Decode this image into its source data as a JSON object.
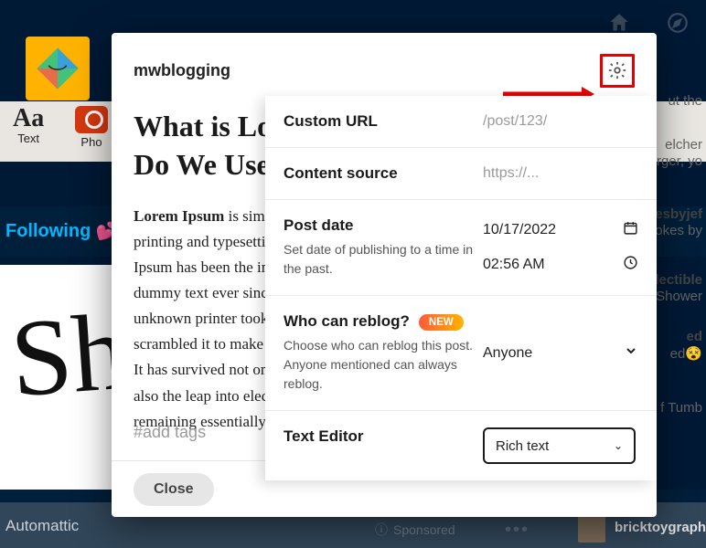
{
  "background": {
    "tools": {
      "text": "Text",
      "photo": "Pho"
    },
    "following": "Following  💕",
    "footer_brand": "Automattic",
    "sponsored": "Sponsored",
    "bottom_user": "bricktoygraph",
    "side_labels": [
      "ut the",
      "elcher",
      "rger, yo",
      "kesbyjef",
      "okes by",
      "lectible",
      "t Shower",
      "ed",
      "ed😵",
      "f Tumb"
    ]
  },
  "compose": {
    "blog_name": "mwblogging",
    "title": "What is Lorem Ipsum? Why Do We Use It?",
    "body_bold": "Lorem Ipsum",
    "body_rest": " is simply dummy text of the printing and typesetting industry. Lorem Ipsum has been the industry's standard dummy text ever since the 1500s, when an unknown printer took a galley of type and scrambled it to make a type specimen book. It has survived not only five centuries, but also the leap into electronic typesetting, remaining essentially unchanged.",
    "tags_placeholder": "#add tags",
    "close": "Close"
  },
  "settings": {
    "custom_url": {
      "label": "Custom URL",
      "value": "/post/123/"
    },
    "content_source": {
      "label": "Content source",
      "value": "https://..."
    },
    "post_date": {
      "label": "Post date",
      "sub": "Set date of publishing to a time in the past.",
      "date": "10/17/2022",
      "time": "02:56 AM"
    },
    "reblog": {
      "label": "Who can reblog?",
      "pill": "NEW",
      "sub": "Choose who can reblog this post. Anyone mentioned can always reblog.",
      "value": "Anyone"
    },
    "editor": {
      "label": "Text Editor",
      "value": "Rich text"
    }
  }
}
